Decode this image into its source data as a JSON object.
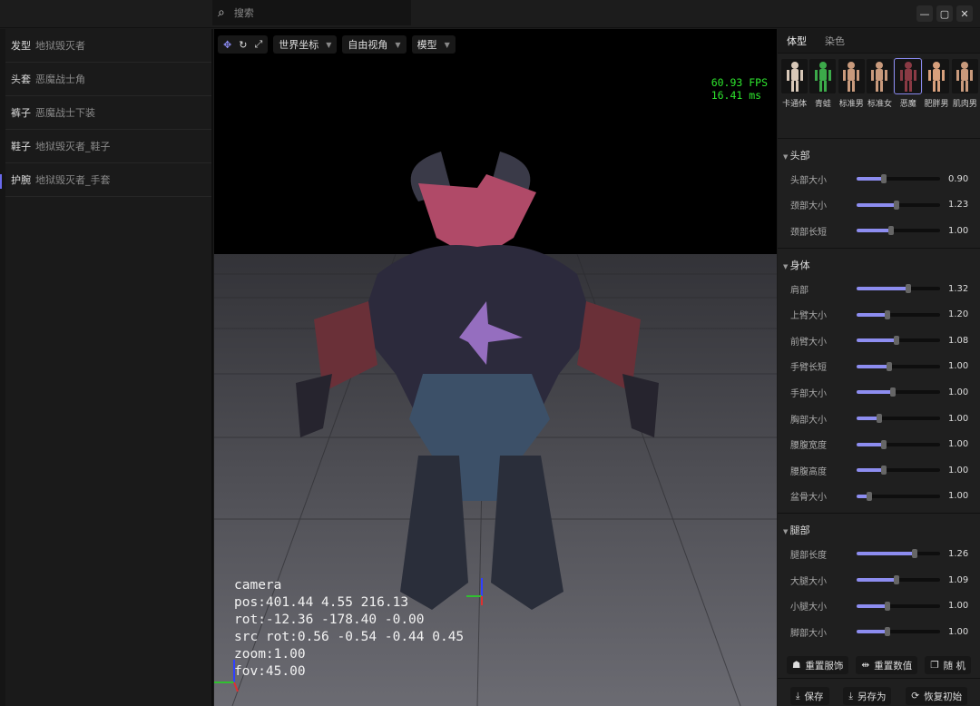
{
  "search": {
    "placeholder": "搜索"
  },
  "window": {
    "minimize": "—",
    "maximize": "▢",
    "close": "✕"
  },
  "equipment": [
    {
      "slot": "发型",
      "name": "地狱毁灭者"
    },
    {
      "slot": "头套",
      "name": "恶魔战士角"
    },
    {
      "slot": "裤子",
      "name": "恶魔战士下装"
    },
    {
      "slot": "鞋子",
      "name": "地狱毁灭者_鞋子"
    },
    {
      "slot": "护腕",
      "name": "地狱毁灭者_手套"
    }
  ],
  "toolbar": {
    "coord": "世界坐标",
    "view": "自由视角",
    "mode": "模型"
  },
  "stats": {
    "fps": "60.93 FPS",
    "ms": "16.41 ms"
  },
  "camera": {
    "title": "camera",
    "pos": "pos:401.44 4.55 216.13",
    "rot": "rot:-12.36 -178.40 -0.00",
    "src_rot": "src rot:0.56 -0.54 -0.44 0.45",
    "zoom": "zoom:1.00",
    "fov": "fov:45.00"
  },
  "tabs": [
    "体型",
    "染色"
  ],
  "bodies": [
    {
      "label": "卡通体",
      "color": "#d8c8b8"
    },
    {
      "label": "青蛙",
      "color": "#3caa4a"
    },
    {
      "label": "标准男",
      "color": "#c99a7c"
    },
    {
      "label": "标准女",
      "color": "#c99a7c"
    },
    {
      "label": "恶魔",
      "color": "#8a3a44",
      "selected": true
    },
    {
      "label": "肥胖男",
      "color": "#d8a07c"
    },
    {
      "label": "肌肉男",
      "color": "#c99a7c"
    }
  ],
  "sections": [
    {
      "title": "头部",
      "sliders": [
        {
          "label": "头部大小",
          "value": "0.90",
          "pos": 0.33
        },
        {
          "label": "颈部大小",
          "value": "1.23",
          "pos": 0.48
        },
        {
          "label": "颈部长短",
          "value": "1.00",
          "pos": 0.41
        }
      ]
    },
    {
      "title": "身体",
      "sliders": [
        {
          "label": "肩部",
          "value": "1.32",
          "pos": 0.62
        },
        {
          "label": "上臂大小",
          "value": "1.20",
          "pos": 0.37
        },
        {
          "label": "前臂大小",
          "value": "1.08",
          "pos": 0.48
        },
        {
          "label": "手臂长短",
          "value": "1.00",
          "pos": 0.39
        },
        {
          "label": "手部大小",
          "value": "1.00",
          "pos": 0.43
        },
        {
          "label": "胸部大小",
          "value": "1.00",
          "pos": 0.27
        },
        {
          "label": "腰腹宽度",
          "value": "1.00",
          "pos": 0.33
        },
        {
          "label": "腰腹高度",
          "value": "1.00",
          "pos": 0.33
        },
        {
          "label": "盆骨大小",
          "value": "1.00",
          "pos": 0.15
        }
      ]
    },
    {
      "title": "腿部",
      "sliders": [
        {
          "label": "腿部长度",
          "value": "1.26",
          "pos": 0.7
        },
        {
          "label": "大腿大小",
          "value": "1.09",
          "pos": 0.48
        },
        {
          "label": "小腿大小",
          "value": "1.00",
          "pos": 0.37
        },
        {
          "label": "脚部大小",
          "value": "1.00",
          "pos": 0.37
        }
      ]
    }
  ],
  "actions": {
    "reset_outfit": "重置服饰",
    "reset_values": "重置数值",
    "random": "随 机",
    "save": "保存",
    "save_as": "另存为",
    "restore": "恢复初始"
  }
}
